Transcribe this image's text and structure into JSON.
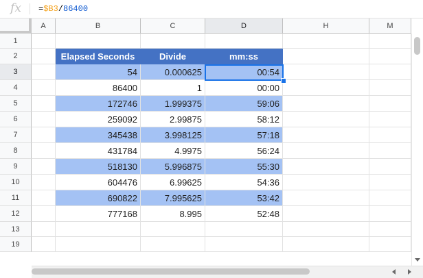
{
  "formula_bar": {
    "fx_label": "fx",
    "eq": "=",
    "ref": "$B3",
    "op": "/",
    "num": "86400"
  },
  "columns": [
    "A",
    "B",
    "C",
    "D",
    "H",
    "M"
  ],
  "rows": [
    "1",
    "2",
    "3",
    "4",
    "5",
    "6",
    "7",
    "8",
    "9",
    "10",
    "11",
    "12",
    "13",
    "19"
  ],
  "table": {
    "headers": [
      "Elapsed Seconds",
      "Divide",
      "mm:ss"
    ],
    "rows": [
      [
        "54",
        "0.000625",
        "00:54"
      ],
      [
        "86400",
        "1",
        "00:00"
      ],
      [
        "172746",
        "1.999375",
        "59:06"
      ],
      [
        "259092",
        "2.99875",
        "58:12"
      ],
      [
        "345438",
        "3.998125",
        "57:18"
      ],
      [
        "431784",
        "4.9975",
        "56:24"
      ],
      [
        "518130",
        "5.996875",
        "55:30"
      ],
      [
        "604476",
        "6.99625",
        "54:36"
      ],
      [
        "690822",
        "7.995625",
        "53:42"
      ],
      [
        "777168",
        "8.995",
        "52:48"
      ]
    ]
  },
  "colors": {
    "header_fill": "#4472c4",
    "band_fill": "#a4c2f4",
    "selection": "#1a73e8"
  }
}
